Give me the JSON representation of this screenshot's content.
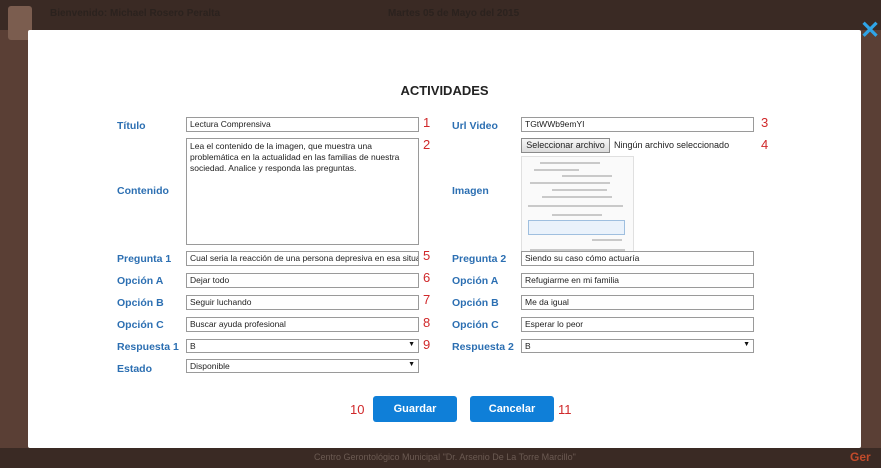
{
  "header": {
    "welcome": "Bienvenido: Michael Rosero Peralta",
    "date": "Martes 05 de Mayo del 2015"
  },
  "footer": {
    "text": "Centro Gerontológico Municipal \"Dr. Arsenio De La Torre Marcillo\"",
    "brand": "Ger"
  },
  "modal": {
    "title": "ACTIVIDADES",
    "close_icon": "close-icon",
    "left": {
      "titulo": {
        "label": "Título",
        "value": "Lectura Comprensiva",
        "num": "1"
      },
      "contenido": {
        "label": "Contenido",
        "value": "Lea el contenido de la imagen, que muestra una problemática en la actualidad en las familias de nuestra sociedad. Analice y responda las preguntas.",
        "num": "2"
      },
      "pregunta1": {
        "label": "Pregunta 1",
        "value": "Cual seria la reacción de una persona depresiva en esa situac",
        "num": "5"
      },
      "opcionA": {
        "label": "Opción A",
        "value": "Dejar todo",
        "num": "6"
      },
      "opcionB": {
        "label": "Opción B",
        "value": "Seguir luchando",
        "num": "7"
      },
      "opcionC": {
        "label": "Opción C",
        "value": "Buscar ayuda profesional",
        "num": "8"
      },
      "respuesta1": {
        "label": "Respuesta 1",
        "value": "B",
        "num": "9"
      },
      "estado": {
        "label": "Estado",
        "value": "Disponible"
      }
    },
    "right": {
      "urlVideo": {
        "label": "Url Video",
        "value": "TGtWWb9emYI",
        "num": "3"
      },
      "imagen": {
        "label": "Imagen",
        "button": "Seleccionar archivo",
        "status": "Ningún archivo seleccionado",
        "num": "4"
      },
      "pregunta2": {
        "label": "Pregunta 2",
        "value": "Siendo su caso cómo actuaría"
      },
      "opcionA": {
        "label": "Opción A",
        "value": "Refugiarme en mi familia"
      },
      "opcionB": {
        "label": "Opción B",
        "value": "Me da igual"
      },
      "opcionC": {
        "label": "Opción C",
        "value": "Esperar lo peor"
      },
      "respuesta2": {
        "label": "Respuesta 2",
        "value": "B"
      }
    },
    "buttons": {
      "guardar": {
        "label": "Guardar",
        "num": "10"
      },
      "cancelar": {
        "label": "Cancelar",
        "num": "11"
      }
    },
    "colors": {
      "label": "#2c6fb2",
      "accent": "#0f7fd8",
      "marker": "#d0282a"
    }
  }
}
